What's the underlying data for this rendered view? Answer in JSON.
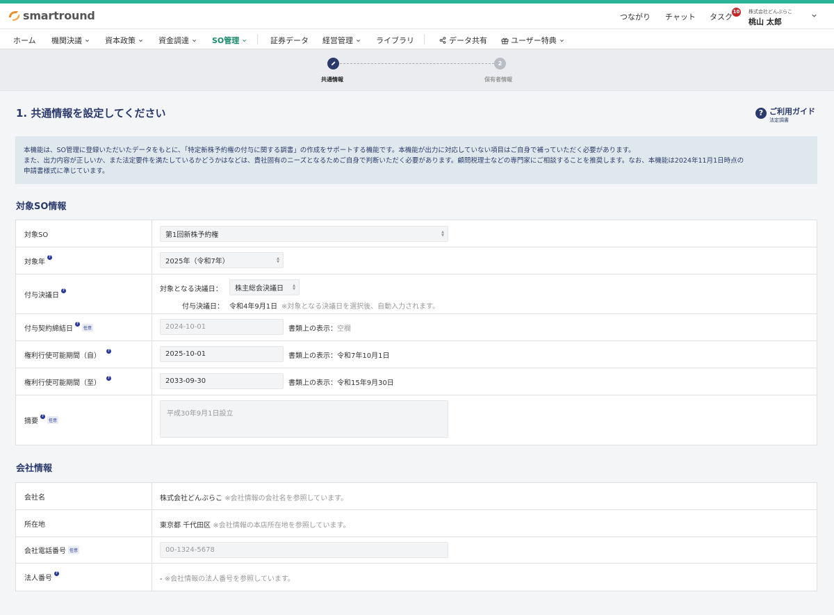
{
  "brand": {
    "name": "smartround",
    "accent": "#2bb39a",
    "logo_color": "#f08a24"
  },
  "header": {
    "links": [
      "つながり",
      "チャット",
      "タスク"
    ],
    "task_count": "10",
    "company": "株式会社どんぶらこ",
    "user": "桃山 太郎"
  },
  "nav": {
    "items": [
      "ホーム",
      "機関決議",
      "資本政策",
      "資金調達",
      "SO管理",
      "証券データ",
      "経営管理",
      "ライブラリ",
      "データ共有",
      "ユーザー特典"
    ],
    "active": "SO管理"
  },
  "stepper": {
    "steps": [
      {
        "label": "共通情報",
        "state": "current",
        "icon": "pencil-icon"
      },
      {
        "label": "保有者情報",
        "state": "pending",
        "number": "2"
      }
    ]
  },
  "page": {
    "title": "1. 共通情報を設定してください",
    "guide_title": "ご利用ガイド",
    "guide_sub": "法定調書",
    "notice_lines": [
      "本機能は、SO管理に登録いただいたデータをもとに、「特定新株予約権の付与に関する調書」の作成をサポートする機能です。本機能が出力に対応していない項目はご自身で補っていただく必要があります。",
      "また、出力内容が正しいか、また法定要件を満たしているかどうかはなどは、貴社固有のニーズとなるためご自身で判断いただく必要があります。顧問税理士などの専門家にご相談することを推奨します。なお、本機能は2024年11月1日時点の",
      "申請書様式に準じています。"
    ]
  },
  "so_section": {
    "title": "対象SO情報",
    "optional_label": "任意",
    "target_so": {
      "label": "対象SO",
      "value": "第1回新株予約権"
    },
    "target_year": {
      "label": "対象年",
      "value": "2025年（令和7年）"
    },
    "grant_date": {
      "label": "付与決議日",
      "basis_label": "対象となる決議日：",
      "basis_value": "株主総会決議日",
      "date_label": "付与決議日：",
      "date_value": "令和4年9月1日",
      "date_note": "※対象となる決議日を選択後、自動入力されます。"
    },
    "contract_date": {
      "label": "付与契約締結日",
      "value": "2024-10-01",
      "display_prefix": "書類上の表示：",
      "display_value": "空欄"
    },
    "exercise_from": {
      "label": "権利行使可能期間（自）",
      "value": "2025-10-01",
      "display_prefix": "書類上の表示：",
      "display_value": "令和7年10月1日"
    },
    "exercise_to": {
      "label": "権利行使可能期間（至）",
      "value": "2033-09-30",
      "display_prefix": "書類上の表示：",
      "display_value": "令和15年9月30日"
    },
    "summary": {
      "label": "摘要",
      "placeholder": "平成30年9月1日設立"
    }
  },
  "company_section": {
    "title": "会社情報",
    "company_name": {
      "label": "会社名",
      "value": "株式会社どんぶらこ",
      "note": "※会社情報の会社名を参照しています。"
    },
    "address": {
      "label": "所在地",
      "value": "東京都 千代田区",
      "note": "※会社情報の本店所在地を参照しています。"
    },
    "phone": {
      "label": "会社電話番号",
      "placeholder": "00-1324-5678"
    },
    "corp_number": {
      "label": "法人番号",
      "value": "-",
      "note": "※会社情報の法人番号を参照しています。"
    }
  }
}
